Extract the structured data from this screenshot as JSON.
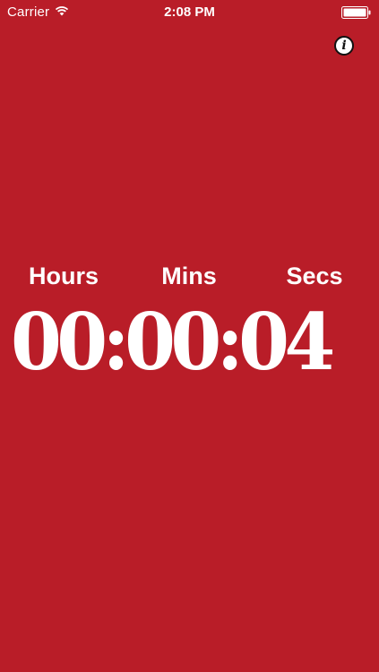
{
  "status_bar": {
    "carrier": "Carrier",
    "time": "2:08 PM",
    "wifi_icon": "wifi-icon",
    "battery_icon": "battery-icon"
  },
  "info_button": {
    "icon": "info-icon",
    "glyph": "i"
  },
  "timer": {
    "labels": {
      "hours": "Hours",
      "mins": "Mins",
      "secs": "Secs"
    },
    "display": "00:00:04"
  },
  "colors": {
    "background": "#B91D28",
    "text": "#FFFFFF"
  }
}
